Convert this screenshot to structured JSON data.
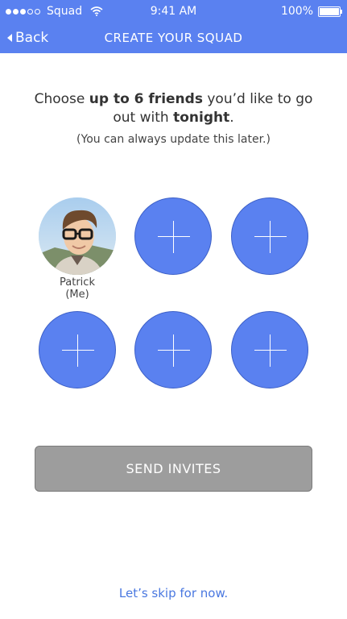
{
  "status_bar": {
    "carrier": "Squad",
    "time": "9:41 AM",
    "battery": "100%"
  },
  "nav": {
    "back_label": "Back",
    "title": "CREATE YOUR SQUAD"
  },
  "prompt": {
    "part1": "Choose ",
    "bold1": "up to 6 friends",
    "part2": " you’d like to go out with ",
    "bold2": "tonight",
    "part3": ".",
    "note": "(You can always update this later.)"
  },
  "member": {
    "name": "Patrick",
    "tag": "(Me)"
  },
  "actions": {
    "send_label": "SEND INVITES",
    "skip_label": "Let’s skip for now."
  },
  "colors": {
    "accent": "#5a81f0",
    "button_gray": "#9d9d9d",
    "link": "#4a78e0"
  }
}
